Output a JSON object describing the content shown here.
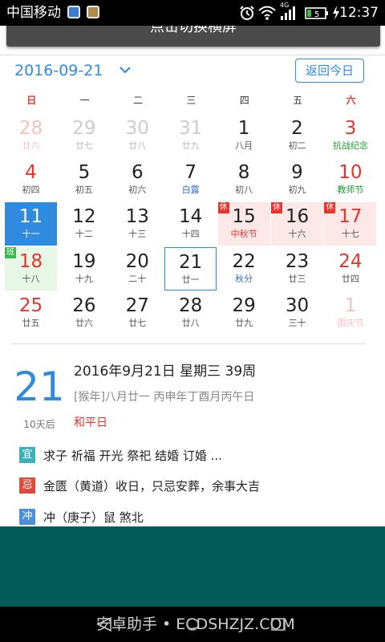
{
  "status_bar": {
    "carrier": "中国移动",
    "time": "12:37",
    "network_badge": "4G",
    "battery_level": "5",
    "icons": [
      "alarm-icon",
      "wifi-icon",
      "signal-icon",
      "battery-icon",
      "charging-icon"
    ]
  },
  "banner": {
    "label": "点击切换横屏"
  },
  "header": {
    "current_date": "2016-09-21",
    "today_button": "返回今日"
  },
  "weekdays": [
    "日",
    "一",
    "二",
    "三",
    "四",
    "五",
    "六"
  ],
  "weeks": [
    [
      {
        "day": "28",
        "sub": "廿六",
        "flags": "faded red"
      },
      {
        "day": "29",
        "sub": "廿七",
        "flags": "faded"
      },
      {
        "day": "30",
        "sub": "廿八",
        "flags": "faded"
      },
      {
        "day": "31",
        "sub": "廿九",
        "flags": "faded"
      },
      {
        "day": "1",
        "sub": "八月",
        "flags": ""
      },
      {
        "day": "2",
        "sub": "初二",
        "flags": ""
      },
      {
        "day": "3",
        "sub": "抗战纪念",
        "flags": "red",
        "sub_color": "green"
      }
    ],
    [
      {
        "day": "4",
        "sub": "初四",
        "flags": "red"
      },
      {
        "day": "5",
        "sub": "初五",
        "flags": ""
      },
      {
        "day": "6",
        "sub": "初六",
        "flags": ""
      },
      {
        "day": "7",
        "sub": "白露",
        "flags": "",
        "sub_color": "blue"
      },
      {
        "day": "8",
        "sub": "初八",
        "flags": ""
      },
      {
        "day": "9",
        "sub": "初九",
        "flags": ""
      },
      {
        "day": "10",
        "sub": "教师节",
        "flags": "red",
        "sub_color": "green"
      }
    ],
    [
      {
        "day": "11",
        "sub": "十一",
        "flags": "selected"
      },
      {
        "day": "12",
        "sub": "十二",
        "flags": ""
      },
      {
        "day": "13",
        "sub": "十三",
        "flags": ""
      },
      {
        "day": "14",
        "sub": "十四",
        "flags": ""
      },
      {
        "day": "15",
        "sub": "中秋节",
        "flags": "holiday",
        "sub_color": "red",
        "tag": "休"
      },
      {
        "day": "16",
        "sub": "十六",
        "flags": "holiday",
        "tag": "休"
      },
      {
        "day": "17",
        "sub": "十七",
        "flags": "holiday red",
        "tag": "休"
      }
    ],
    [
      {
        "day": "18",
        "sub": "十八",
        "flags": "workday red",
        "tag": "班"
      },
      {
        "day": "19",
        "sub": "十九",
        "flags": ""
      },
      {
        "day": "20",
        "sub": "二十",
        "flags": ""
      },
      {
        "day": "21",
        "sub": "廿一",
        "flags": "today"
      },
      {
        "day": "22",
        "sub": "秋分",
        "flags": "",
        "sub_color": "blue"
      },
      {
        "day": "23",
        "sub": "廿三",
        "flags": ""
      },
      {
        "day": "24",
        "sub": "廿四",
        "flags": "red"
      }
    ],
    [
      {
        "day": "25",
        "sub": "廿五",
        "flags": "red"
      },
      {
        "day": "26",
        "sub": "廿六",
        "flags": ""
      },
      {
        "day": "27",
        "sub": "廿七",
        "flags": ""
      },
      {
        "day": "28",
        "sub": "廿八",
        "flags": ""
      },
      {
        "day": "29",
        "sub": "廿九",
        "flags": ""
      },
      {
        "day": "30",
        "sub": "三十",
        "flags": ""
      },
      {
        "day": "1",
        "sub": "国庆节",
        "flags": "faded red"
      }
    ]
  ],
  "detail": {
    "big_day": "21",
    "days_after": "10天后",
    "full_date": "2016年9月21日 星期三 39周",
    "lunar": "[猴年]八月廿一 丙申年丁酉月丙午日",
    "festival": "和平日",
    "yi_label": "宜",
    "yi_text": "求子  祈福  开光  祭祀  结婚  订婚  ...",
    "ji_label": "忌",
    "ji_text": "金匮（黄道）收日，只忌安葬，余事大吉",
    "chong_label": "冲",
    "chong_text": "冲（庚子）鼠  煞北"
  },
  "colors": {
    "accent": "#2f8be0",
    "red": "#e5342b",
    "green": "#1d9a2f",
    "yi_badge": "#3ab0b8",
    "ji_badge": "#e04a3a",
    "chong_badge": "#4a90d9",
    "panel": "#045a56"
  },
  "navbar": {
    "watermark": "安卓助手 • ECDSHZJZ.COM"
  }
}
